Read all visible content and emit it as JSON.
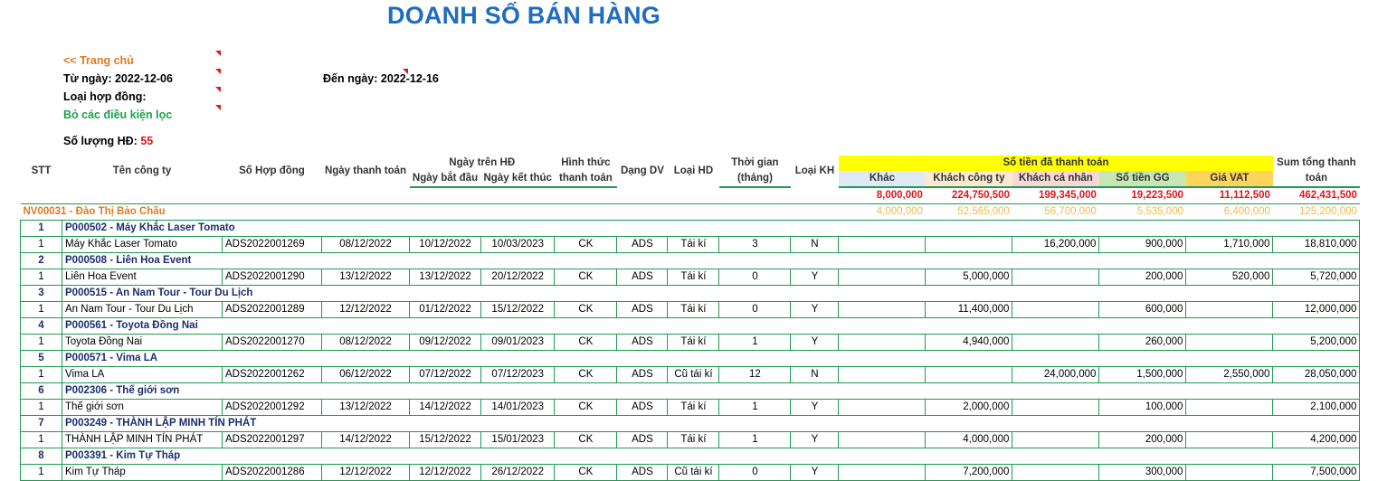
{
  "report": {
    "title": "DOANH SỐ BÁN HÀNG",
    "home_link": "<< Trang chủ",
    "from_label": "Từ ngày:",
    "from_value": "2022-12-06",
    "to_label": "Đến ngày:",
    "to_value": "2022-12-16",
    "contract_type_label": "Loại hợp đồng:",
    "clear_filters": "Bỏ các điều kiện lọc",
    "count_label": "Số lượng HĐ:",
    "count_value": "55"
  },
  "headers": {
    "stt": "STT",
    "company": "Tên công ty",
    "contract_no": "Số Hợp đồng",
    "pay_date": "Ngày thanh toán",
    "contract_date_group": "Ngày trên HĐ",
    "start_date": "Ngày bắt đầu",
    "end_date": "Ngày kết thúc",
    "pay_method_1": "Hình thức",
    "pay_method_2": "thanh toán",
    "service_type": "Dạng DV",
    "contract_type": "Loại HD",
    "duration_1": "Thời gian",
    "duration_2": "(tháng)",
    "customer_type": "Loại KH",
    "paid_group": "Số tiền đã thanh toán",
    "other": "Khác",
    "corporate": "Khách công ty",
    "individual": "Khách cá nhân",
    "discount": "Số tiền GG",
    "vat": "Giá VAT",
    "sum_1": "Sum tổng thanh",
    "sum_2": "toán"
  },
  "totals": {
    "other": "8,000,000",
    "corporate": "224,750,500",
    "individual": "199,345,000",
    "discount": "19,223,500",
    "vat": "11,112,500",
    "sum": "462,431,500"
  },
  "employee": {
    "name": "NV00031 - Đào Thị Bảo Châu",
    "other": "4,000,000",
    "corporate": "52,565,000",
    "individual": "56,700,000",
    "discount": "5,535,000",
    "vat": "6,400,000",
    "sum": "125,200,000"
  },
  "groups": [
    {
      "no": "1",
      "name": "P000502 - Máy Khắc Laser Tomato",
      "row": {
        "stt": "1",
        "company": "Máy Khắc Laser Tomato",
        "contract": "ADS2022001269",
        "pay_date": "08/12/2022",
        "start": "10/12/2022",
        "end": "10/03/2023",
        "method": "CK",
        "service": "ADS",
        "ctype": "Tái kí",
        "months": "3",
        "ktype": "N",
        "other": "",
        "corporate": "",
        "individual": "16,200,000",
        "discount": "900,000",
        "vat": "1,710,000",
        "sum": "18,810,000"
      }
    },
    {
      "no": "2",
      "name": "P000508 - Liên Hoa Event",
      "row": {
        "stt": "1",
        "company": "Liên Hoa Event",
        "contract": "ADS2022001290",
        "pay_date": "13/12/2022",
        "start": "13/12/2022",
        "end": "20/12/2022",
        "method": "CK",
        "service": "ADS",
        "ctype": "Tái kí",
        "months": "0",
        "ktype": "Y",
        "other": "",
        "corporate": "5,000,000",
        "individual": "",
        "discount": "200,000",
        "vat": "520,000",
        "sum": "5,720,000"
      }
    },
    {
      "no": "3",
      "name": "P000515 - An Nam Tour - Tour Du Lịch",
      "row": {
        "stt": "1",
        "company": "An Nam Tour - Tour Du Lịch",
        "contract": "ADS2022001289",
        "pay_date": "12/12/2022",
        "start": "01/12/2022",
        "end": "15/12/2022",
        "method": "CK",
        "service": "ADS",
        "ctype": "Tái kí",
        "months": "0",
        "ktype": "Y",
        "other": "",
        "corporate": "11,400,000",
        "individual": "",
        "discount": "600,000",
        "vat": "",
        "sum": "12,000,000"
      }
    },
    {
      "no": "4",
      "name": "P000561 - Toyota Đồng Nai",
      "row": {
        "stt": "1",
        "company": "Toyota Đồng Nai",
        "contract": "ADS2022001270",
        "pay_date": "08/12/2022",
        "start": "09/12/2022",
        "end": "09/01/2023",
        "method": "CK",
        "service": "ADS",
        "ctype": "Tái kí",
        "months": "1",
        "ktype": "Y",
        "other": "",
        "corporate": "4,940,000",
        "individual": "",
        "discount": "260,000",
        "vat": "",
        "sum": "5,200,000"
      }
    },
    {
      "no": "5",
      "name": "P000571 - Vima LA",
      "row": {
        "stt": "1",
        "company": "Vima LA",
        "contract": "ADS2022001262",
        "pay_date": "06/12/2022",
        "start": "07/12/2022",
        "end": "07/12/2023",
        "method": "CK",
        "service": "ADS",
        "ctype": "Cũ tái kí",
        "months": "12",
        "ktype": "N",
        "other": "",
        "corporate": "",
        "individual": "24,000,000",
        "discount": "1,500,000",
        "vat": "2,550,000",
        "sum": "28,050,000"
      }
    },
    {
      "no": "6",
      "name": "P002306 - Thế giới sơn",
      "row": {
        "stt": "1",
        "company": "Thế giới sơn",
        "contract": "ADS2022001292",
        "pay_date": "13/12/2022",
        "start": "14/12/2022",
        "end": "14/01/2023",
        "method": "CK",
        "service": "ADS",
        "ctype": "Tái kí",
        "months": "1",
        "ktype": "Y",
        "other": "",
        "corporate": "2,000,000",
        "individual": "",
        "discount": "100,000",
        "vat": "",
        "sum": "2,100,000"
      }
    },
    {
      "no": "7",
      "name": "P003249 - THÀNH LẬP MINH TÍN PHÁT",
      "row": {
        "stt": "1",
        "company": "THÀNH LẬP MINH TÍN PHÁT",
        "contract": "ADS2022001297",
        "pay_date": "14/12/2022",
        "start": "15/12/2022",
        "end": "15/01/2023",
        "method": "CK",
        "service": "ADS",
        "ctype": "Tái kí",
        "months": "1",
        "ktype": "Y",
        "other": "",
        "corporate": "4,000,000",
        "individual": "",
        "discount": "200,000",
        "vat": "",
        "sum": "4,200,000"
      }
    },
    {
      "no": "8",
      "name": "P003391 - Kim Tự Tháp",
      "row": {
        "stt": "1",
        "company": "Kim Tự Tháp",
        "contract": "ADS2022001286",
        "pay_date": "12/12/2022",
        "start": "12/12/2022",
        "end": "26/12/2022",
        "method": "CK",
        "service": "ADS",
        "ctype": "Cũ tái kí",
        "months": "0",
        "ktype": "Y",
        "other": "",
        "corporate": "7,200,000",
        "individual": "",
        "discount": "300,000",
        "vat": "",
        "sum": "7,500,000"
      }
    }
  ]
}
